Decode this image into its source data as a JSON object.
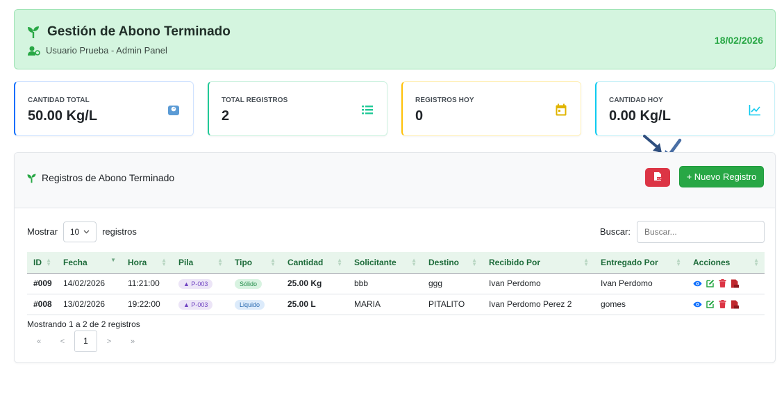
{
  "header": {
    "title": "Gestión de Abono Terminado",
    "user": "Usuario Prueba - Admin Panel",
    "date": "18/02/2026"
  },
  "stats": [
    {
      "label": "CANTIDAD TOTAL",
      "value": "50.00 Kg/L",
      "icon": "weight-icon",
      "color": "#5b9bd5"
    },
    {
      "label": "TOTAL REGISTROS",
      "value": "2",
      "icon": "list-icon",
      "color": "#20c997"
    },
    {
      "label": "REGISTROS HOY",
      "value": "0",
      "icon": "calendar-icon",
      "color": "#e0b400"
    },
    {
      "label": "CANTIDAD HOY",
      "value": "0.00 Kg/L",
      "icon": "chart-line-icon",
      "color": "#0dcaf0"
    }
  ],
  "panel": {
    "title": "Registros de Abono Terminado",
    "new_button": "+ Nuevo Registro",
    "show_label": "Mostrar",
    "page_size": "10",
    "records_label": "registros",
    "search_label": "Buscar:",
    "search_placeholder": "Buscar..."
  },
  "table": {
    "columns": [
      "ID",
      "Fecha",
      "Hora",
      "Pila",
      "Tipo",
      "Cantidad",
      "Solicitante",
      "Destino",
      "Recibido Por",
      "Entregado Por",
      "Acciones"
    ],
    "rows": [
      {
        "id": "#009",
        "fecha": "14/02/2026",
        "hora": "11:21:00",
        "pila": "P-003",
        "tipo": "Sólido",
        "cantidad": "25.00 Kg",
        "solicitante": "bbb",
        "destino": "ggg",
        "recibido": "Ivan Perdomo",
        "entregado": "Ivan Perdomo"
      },
      {
        "id": "#008",
        "fecha": "13/02/2026",
        "hora": "19:22:00",
        "pila": "P-003",
        "tipo": "Liquido",
        "cantidad": "25.00 L",
        "solicitante": "MARIA",
        "destino": "PITALITO",
        "recibido": "Ivan Perdomo Perez 2",
        "entregado": "gomes"
      }
    ]
  },
  "footer": {
    "info": "Mostrando 1 a 2 de 2 registros",
    "first": "«",
    "prev": "<",
    "page": "1",
    "next": ">",
    "last": "»"
  },
  "colors": {
    "primary_green": "#28a745",
    "danger": "#dc3545",
    "header_bg": "#d4f5df"
  }
}
